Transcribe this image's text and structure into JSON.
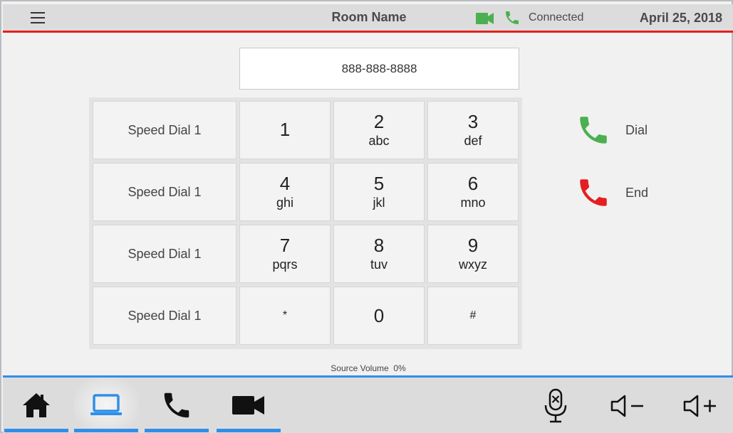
{
  "header": {
    "menu_icon": "hamburger-menu-icon",
    "room_name": "Room Name",
    "camera_icon": "video-camera-icon",
    "phone_icon": "phone-icon",
    "status": "Connected",
    "date": "April 25, 2018",
    "accent_color": "#e41f1f",
    "status_icon_color": "#4caf50"
  },
  "dialer": {
    "number": "888-888-8888",
    "speed_dials": [
      "Speed Dial 1",
      "Speed Dial 1",
      "Speed Dial 1",
      "Speed Dial 1"
    ],
    "keys": [
      {
        "digit": "1",
        "letters": ""
      },
      {
        "digit": "2",
        "letters": "abc"
      },
      {
        "digit": "3",
        "letters": "def"
      },
      {
        "digit": "4",
        "letters": "ghi"
      },
      {
        "digit": "5",
        "letters": "jkl"
      },
      {
        "digit": "6",
        "letters": "mno"
      },
      {
        "digit": "7",
        "letters": "pqrs"
      },
      {
        "digit": "8",
        "letters": "tuv"
      },
      {
        "digit": "9",
        "letters": "wxyz"
      },
      {
        "digit": "*",
        "letters": ""
      },
      {
        "digit": "0",
        "letters": ""
      },
      {
        "digit": "#",
        "letters": ""
      }
    ],
    "dial_label": "Dial",
    "end_label": "End",
    "dial_color": "#4caf50",
    "end_color": "#e41f1f"
  },
  "source_volume": {
    "label": "Source Volume",
    "value": "0%"
  },
  "footer": {
    "nav": [
      {
        "name": "home",
        "icon": "home-icon",
        "active": false
      },
      {
        "name": "laptop",
        "icon": "laptop-icon",
        "active": true
      },
      {
        "name": "phone",
        "icon": "phone-icon",
        "active": false
      },
      {
        "name": "video",
        "icon": "video-camera-icon",
        "active": false
      }
    ],
    "controls": [
      {
        "name": "mic-mute",
        "icon": "microphone-mute-icon"
      },
      {
        "name": "volume-down",
        "icon": "volume-down-icon"
      },
      {
        "name": "volume-up",
        "icon": "volume-up-icon"
      }
    ],
    "accent_color": "#2f8fe8"
  }
}
